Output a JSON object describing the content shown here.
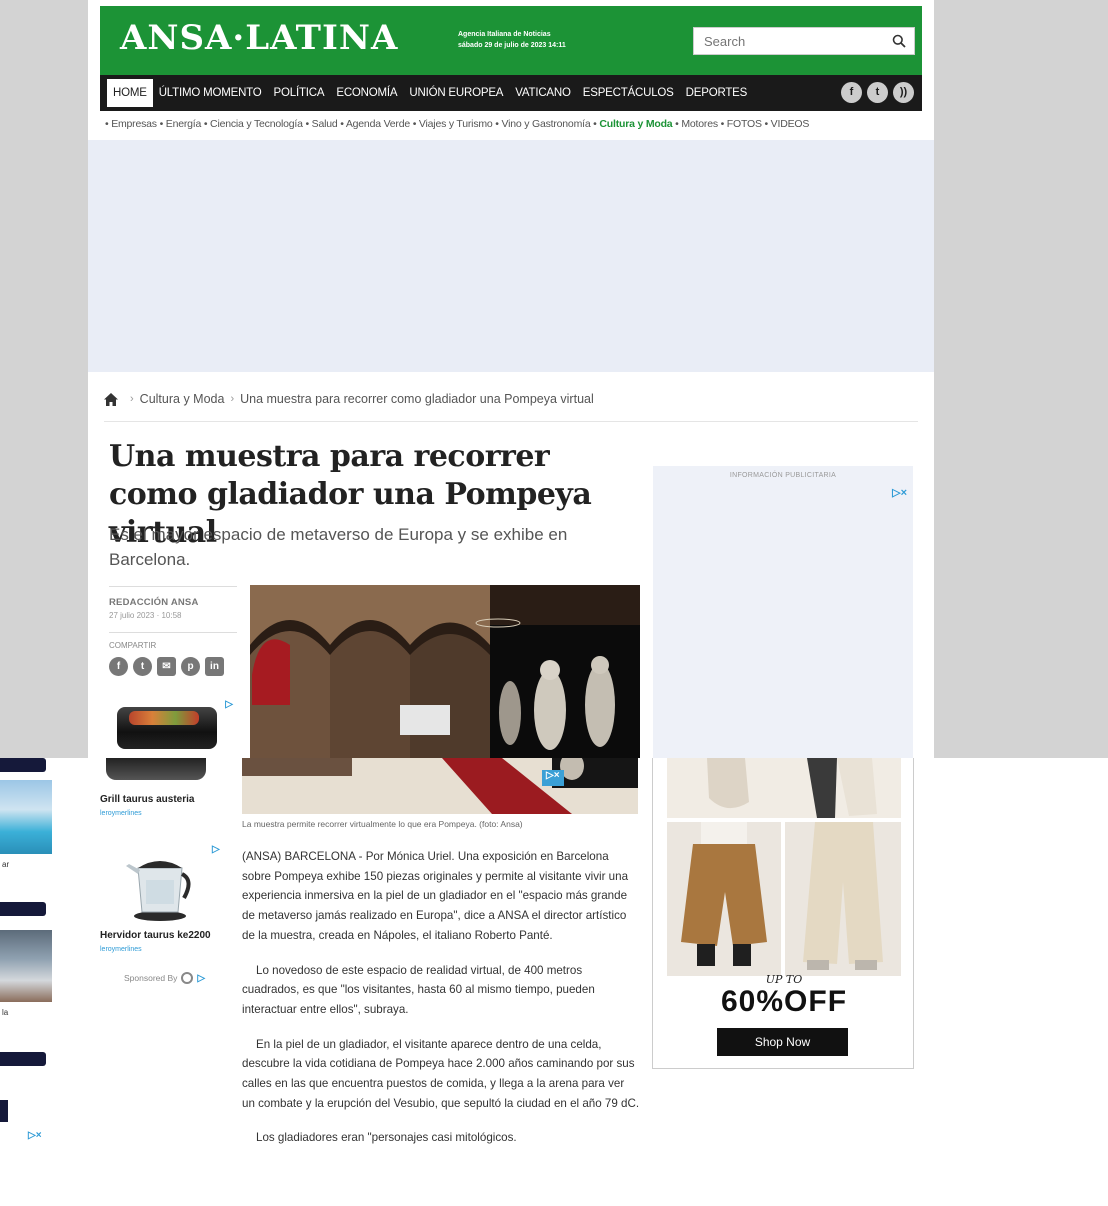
{
  "header": {
    "logo": "ANSA·LATINA",
    "tagline_line1": "Agencia Italiana de Noticias",
    "tagline_line2": "sábado 29 de julio de 2023 14:11",
    "search_placeholder": "Search",
    "brand_color": "#1c9336"
  },
  "nav": {
    "items": [
      "HOME",
      "ÚLTIMO MOMENTO",
      "POLÍTICA",
      "ECONOMÍA",
      "UNIÓN EUROPEA",
      "VATICANO",
      "ESPECTÁCULOS",
      "DEPORTES"
    ],
    "social": [
      "facebook-icon",
      "twitter-icon",
      "rss-icon"
    ]
  },
  "subnav": {
    "before": "• Empresas • Energía • Ciencia y Tecnología • Salud • Agenda Verde • Viajes y Turismo • Vino y Gastronomía • ",
    "highlight": "Cultura y Moda",
    "after": " • Motores • FOTOS • VIDEOS"
  },
  "breadcrumb": {
    "section": "Cultura y Moda",
    "current": "Una muestra para recorrer como gladiador una Pompeya virtual"
  },
  "article": {
    "title": "Una muestra para recorrer como gladiador una Pompeya virtual",
    "subtitle": "Es el mayor espacio de metaverso de Europa y se exhibe en Barcelona.",
    "author": "REDACCIÓN ANSA",
    "date": "27 julio 2023 · 10:58",
    "share_label": "COMPARTIR",
    "caption": "La muestra permite recorrer virtualmente lo que era Pompeya. (foto: Ansa)",
    "paragraphs": [
      "(ANSA) BARCELONA - Por Mónica Uriel. Una exposición en Barcelona sobre Pompeya exhibe 150 piezas originales y permite al visitante vivir una experiencia inmersiva en la piel de un gladiador en el \"espacio más grande de metaverso jamás realizado en Europa\", dice a ANSA el director artístico de la muestra, creada en Nápoles, el italiano Roberto Panté.",
      "Lo novedoso de este espacio de realidad virtual, de 400 metros cuadrados, es que \"los visitantes, hasta 60 al mismo tiempo, pueden interactuar entre ellos\", subraya.",
      "En la piel de un gladiador, el visitante aparece dentro de una celda, descubre la vida cotidiana de Pompeya hace 2.000 años caminando por sus calles en las que encuentra puestos de comida, y llega a la arena para ver un combate y la erupción del Vesubio, que sepultó la ciudad en el año 79 dC.",
      "Los gladiadores eran \"personajes casi mitológicos."
    ]
  },
  "ads": {
    "info_label": "INFORMACIÓN PUBLICITARIA",
    "grill_name": "Grill taurus austeria",
    "grill_brand": "leroymerlines",
    "kettle_name": "Hervidor taurus ke2200",
    "kettle_brand": "leroymerlines",
    "sponsored": "Sponsored By",
    "promo_upto": "UP TO",
    "promo_discount": "60%OFF",
    "promo_button": "Shop Now",
    "adchoice": "▷×"
  },
  "left_panel": {
    "text1": "ar",
    "text2": "la"
  }
}
